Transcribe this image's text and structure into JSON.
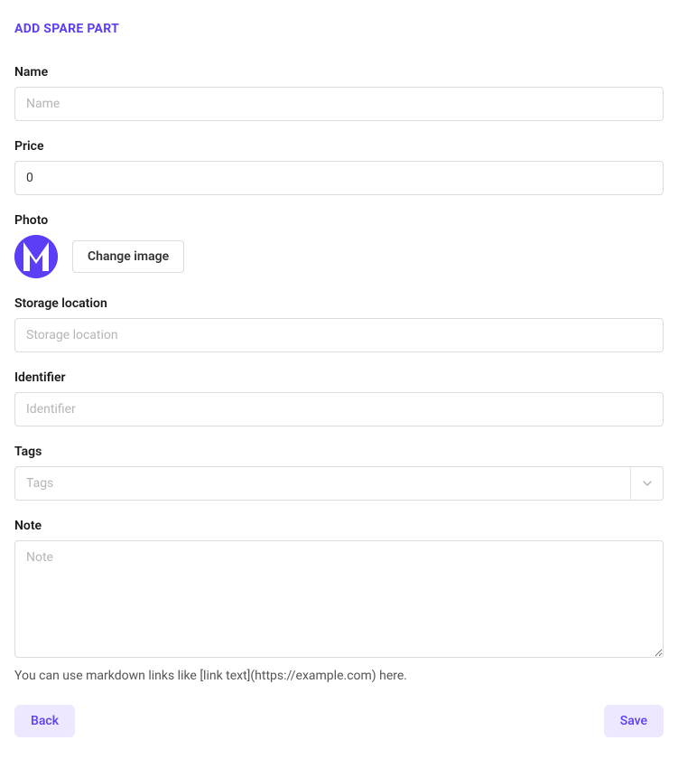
{
  "page": {
    "title": "ADD SPARE PART"
  },
  "form": {
    "name": {
      "label": "Name",
      "placeholder": "Name",
      "value": ""
    },
    "price": {
      "label": "Price",
      "value": "0"
    },
    "photo": {
      "label": "Photo",
      "change_button": "Change image"
    },
    "storage_location": {
      "label": "Storage location",
      "placeholder": "Storage location",
      "value": ""
    },
    "identifier": {
      "label": "Identifier",
      "placeholder": "Identifier",
      "value": ""
    },
    "tags": {
      "label": "Tags",
      "placeholder": "Tags"
    },
    "note": {
      "label": "Note",
      "placeholder": "Note",
      "value": "",
      "help_text": "You can use markdown links like [link text](https://example.com) here."
    }
  },
  "actions": {
    "back": "Back",
    "save": "Save"
  },
  "colors": {
    "accent": "#5b3ef5",
    "accent_light": "#ede8ff"
  }
}
